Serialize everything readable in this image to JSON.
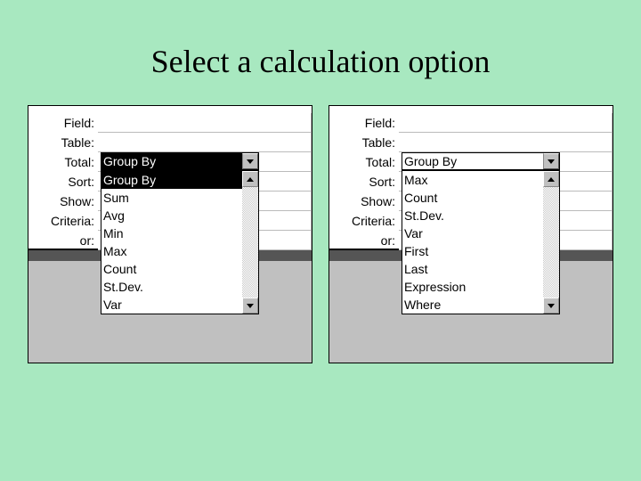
{
  "title": "Select a calculation option",
  "rowLabels": [
    "Field:",
    "Table:",
    "Total:",
    "Sort:",
    "Show:",
    "Criteria:",
    "or:"
  ],
  "left": {
    "comboValue": "Group By",
    "options": [
      "Group By",
      "Sum",
      "Avg",
      "Min",
      "Max",
      "Count",
      "St.Dev.",
      "Var"
    ]
  },
  "right": {
    "comboValue": "Group By",
    "options": [
      "Max",
      "Count",
      "St.Dev.",
      "Var",
      "First",
      "Last",
      "Expression",
      "Where"
    ]
  }
}
